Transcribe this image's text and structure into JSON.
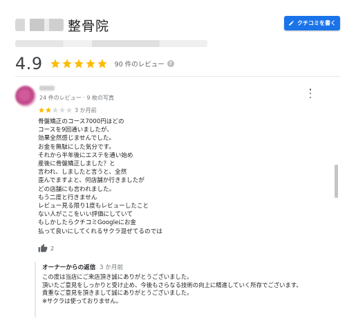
{
  "place": {
    "name_visible": "整骨院",
    "name_blurred_prefix": "〇〇〇",
    "address_blurred": "〇〇〇〇〇〇〇〇〇〇〇〇〇〇〇〇〇"
  },
  "write_review_button": {
    "label": "クチコミを書く"
  },
  "rating": {
    "value": "4.9",
    "stars": 5,
    "count_label": "90 件のレビュー",
    "help_glyph": "?"
  },
  "review": {
    "reviewer_meta": "24 件のレビュー · 9 枚の写真",
    "rating": 2,
    "max_rating": 5,
    "date": "3 か月前",
    "lines": [
      "骨盤矯正のコース7000円ほどの",
      "コースを9回通いましたが、",
      "効果全然感じませんでした。",
      "お金を無駄にした気分です。",
      "それから半年後にエステを通い始め",
      "産後に骨盤矯正しました？と",
      "言われ、しましたと言うと、全然",
      "歪んでますよと、何店舗か行きましたが",
      "どの店舗にも言われました。",
      "もう二度と行きません",
      "レビュー見る限り1度もレビューしたこと",
      "ない人がここをいい評価にしていて",
      "もしかしたらクチコミGoogleにお金",
      "払って良いにしてくれるサクラ混ぜてるのでは"
    ],
    "like_count": "2"
  },
  "owner_reply": {
    "label": "オーナーからの返信",
    "date": "3 か月前",
    "lines": [
      "この度は当店にご来店頂き誠にありがとうございました。",
      "頂いたご意見をしっかりと受け止め、今後もさらなる技術の向上に精進していく所存でございます。",
      "貴重なご意見を頂きまして誠にありがとうございました。",
      "※サクラは使っておりません。"
    ]
  },
  "colors": {
    "star_filled": "#fbbc04",
    "star_empty": "#dadce0",
    "accent": "#1a73e8"
  }
}
